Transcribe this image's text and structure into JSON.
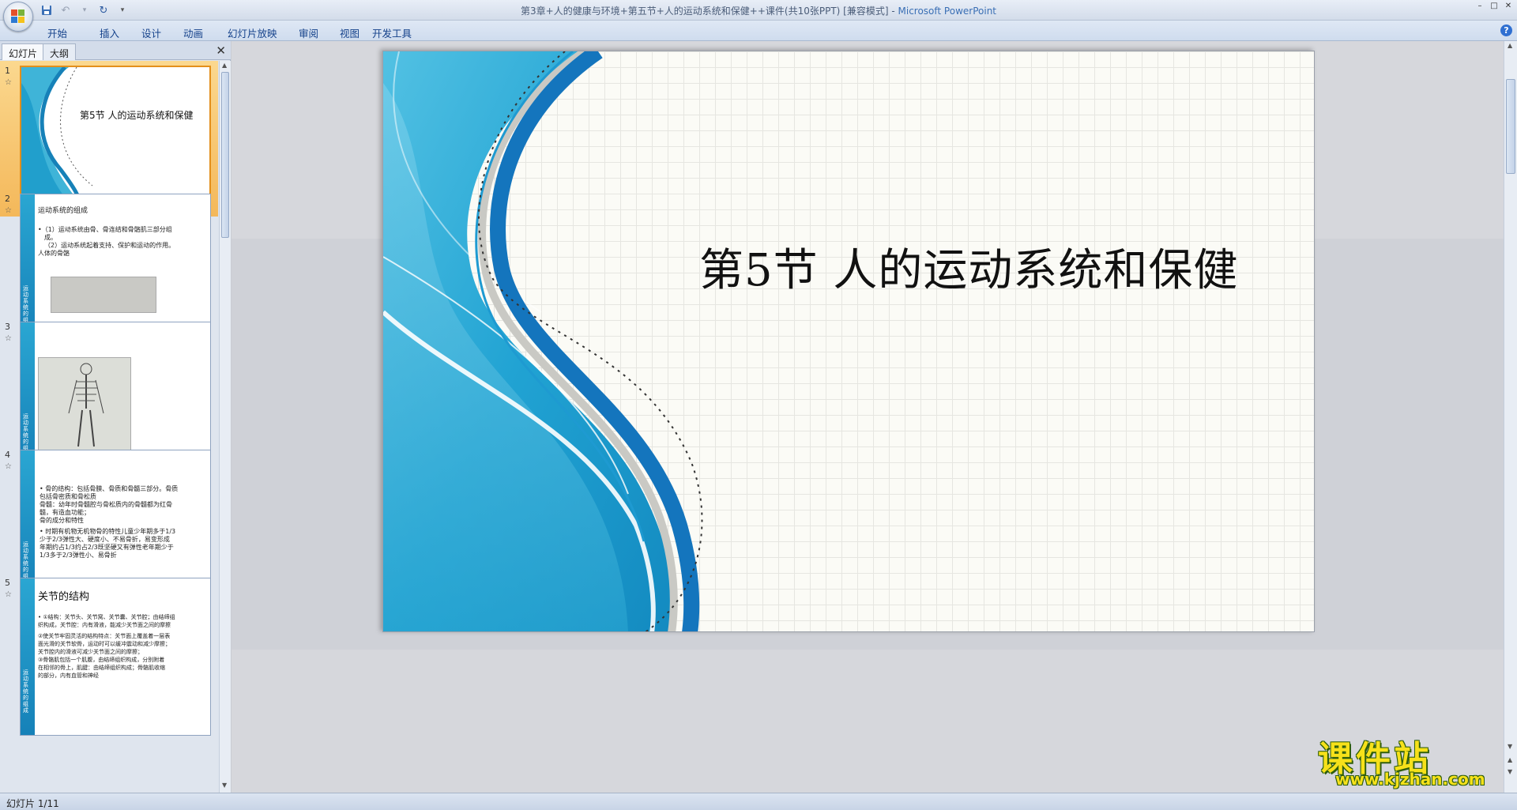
{
  "window": {
    "doc_title": "第3章+人的健康与环境+第五节+人的运动系统和保健++课件(共10张PPT) [兼容模式]",
    "separator": " - ",
    "app_name": "Microsoft PowerPoint",
    "min": "–",
    "max": "□",
    "close": "✕"
  },
  "qat": {
    "dropdown": "▾"
  },
  "ribbon": {
    "tabs": [
      "开始",
      "插入",
      "设计",
      "动画",
      "幻灯片放映",
      "审阅",
      "视图",
      "开发工具"
    ],
    "help": "?"
  },
  "left_pane": {
    "tabs": [
      "幻灯片",
      "大纲"
    ],
    "close": "✕",
    "slides": [
      {
        "num": "1",
        "star": "☆",
        "title": "第5节  人的运动系统和保健"
      },
      {
        "num": "2",
        "star": "☆",
        "heading": "运动系统的组成",
        "lines": [
          "•（1）运动系统由骨、骨连结和骨骼肌三部分组",
          "成。",
          "（2）运动系统起着支持、保护和运动的作用。",
          "人体的骨骼"
        ],
        "strip": "运动系统的组成"
      },
      {
        "num": "3",
        "star": "☆",
        "strip": "运动系统的组成"
      },
      {
        "num": "4",
        "star": "☆",
        "lines": [
          "• 骨的结构：包括骨膜、骨质和骨髓三部分。骨质",
          "  包括骨密质和骨松质",
          "  骨髓：幼年时骨髓腔与骨松质内的骨髓都为红骨",
          "  髓，有造血功能；",
          "  骨的成分和特性",
          "• 时期有机物无机物骨的特性儿童少年期多于1/3",
          "  少于2/3弹性大、硬度小、不易骨折，易变形成",
          "  年期约占1/3约占2/3既坚硬又有弹性老年期少于",
          "  1/3多于2/3弹性小、易骨折"
        ],
        "strip": "运动系统的组成"
      },
      {
        "num": "5",
        "star": "☆",
        "heading": "关节的结构",
        "lines": [
          "• ①结构：关节头、关节窝、关节囊、关节腔；由结缔组",
          "  织构成，关节腔：内有滑液，能减少关节面之间的摩擦",
          "  ②使关节牢固灵活的结构特点：关节面上覆盖着一层表",
          "  面光滑的关节软骨，运动时可以缓冲震动和减少摩擦；",
          "  关节腔内的滑液可减少关节面之间的摩擦；",
          "  ③骨骼肌包括一个肌腹，由结缔组织构成，分别附着",
          "  在相邻的骨上，肌腱：由结缔组织构成；骨骼肌收缩",
          "  的部分，内有血管和神经"
        ],
        "strip": "运动系统的组成"
      }
    ]
  },
  "slide": {
    "title": "第5节  人的运动系统和保健"
  },
  "status": {
    "text": "幻灯片 1/11"
  },
  "watermark": {
    "main": "课件站",
    "url": "www.kjzhan.com"
  },
  "colors": {
    "accent_blue": "#1681b8",
    "selection_orange": "#f4b85a",
    "title_blue": "#3a6fb5"
  }
}
